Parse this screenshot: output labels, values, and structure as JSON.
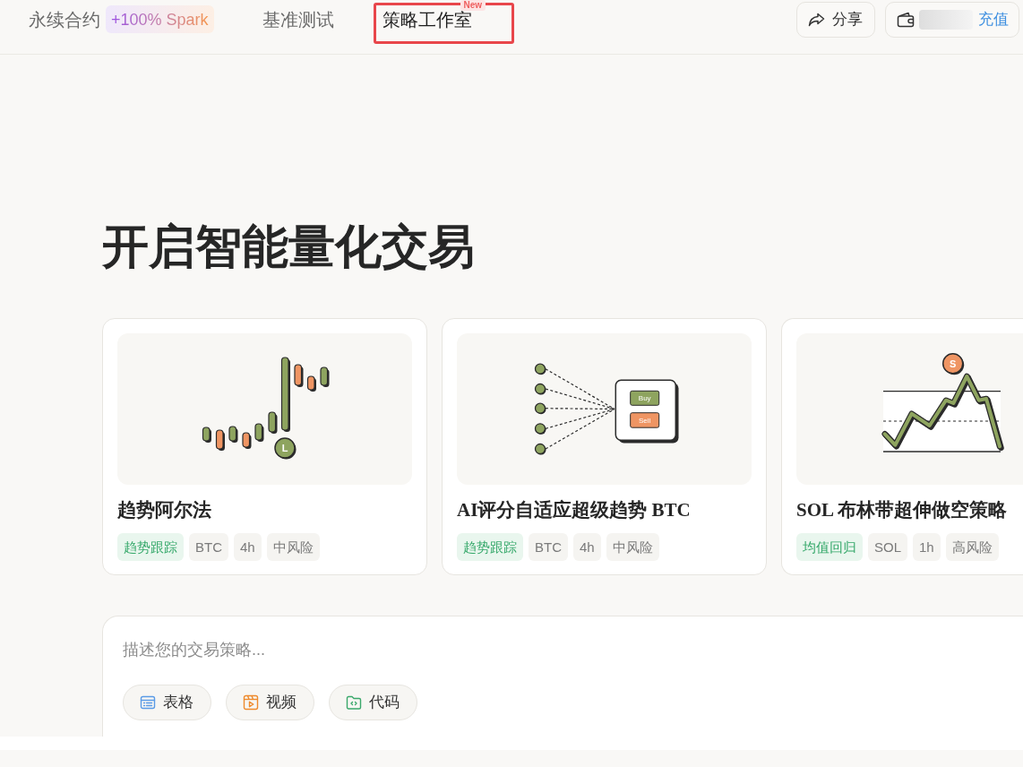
{
  "header": {
    "tabs": [
      {
        "label": "永续合约",
        "selected": false,
        "highlighted": false,
        "badge": {
          "kind": "promo",
          "text": "+100% Spark"
        }
      },
      {
        "label": "基准测试",
        "selected": false,
        "highlighted": false
      },
      {
        "label": "策略工作室",
        "selected": true,
        "highlighted": true,
        "badge": {
          "kind": "new",
          "text": "New"
        }
      }
    ],
    "share_button": {
      "label": "分享"
    },
    "wallet": {
      "top_up": "充值"
    }
  },
  "hero": {
    "title": "开启智能量化交易"
  },
  "strategy_cards": [
    {
      "title": "趋势阿尔法",
      "illustration": {
        "kind": "candles",
        "marker": "L"
      },
      "tags": [
        {
          "label": "趋势跟踪",
          "kind": "category"
        },
        {
          "label": "BTC",
          "kind": "plain"
        },
        {
          "label": "4h",
          "kind": "plain"
        },
        {
          "label": "中风险",
          "kind": "plain"
        }
      ]
    },
    {
      "title": "AI评分自适应超级趋势 BTC",
      "illustration": {
        "kind": "network",
        "buy": "Buy",
        "sell": "Sell"
      },
      "tags": [
        {
          "label": "趋势跟踪",
          "kind": "category"
        },
        {
          "label": "BTC",
          "kind": "plain"
        },
        {
          "label": "4h",
          "kind": "plain"
        },
        {
          "label": "中风险",
          "kind": "plain"
        }
      ]
    },
    {
      "title": "SOL 布林带超伸做空策略",
      "illustration": {
        "kind": "bands",
        "marker": "S"
      },
      "tags": [
        {
          "label": "均值回归",
          "kind": "category"
        },
        {
          "label": "SOL",
          "kind": "plain"
        },
        {
          "label": "1h",
          "kind": "plain"
        },
        {
          "label": "高风险",
          "kind": "plain"
        }
      ]
    }
  ],
  "composer": {
    "placeholder": "描述您的交易策略...",
    "attachments": [
      {
        "label": "表格",
        "kind": "table"
      },
      {
        "label": "视频",
        "kind": "video"
      },
      {
        "label": "代码",
        "kind": "code"
      }
    ]
  }
}
